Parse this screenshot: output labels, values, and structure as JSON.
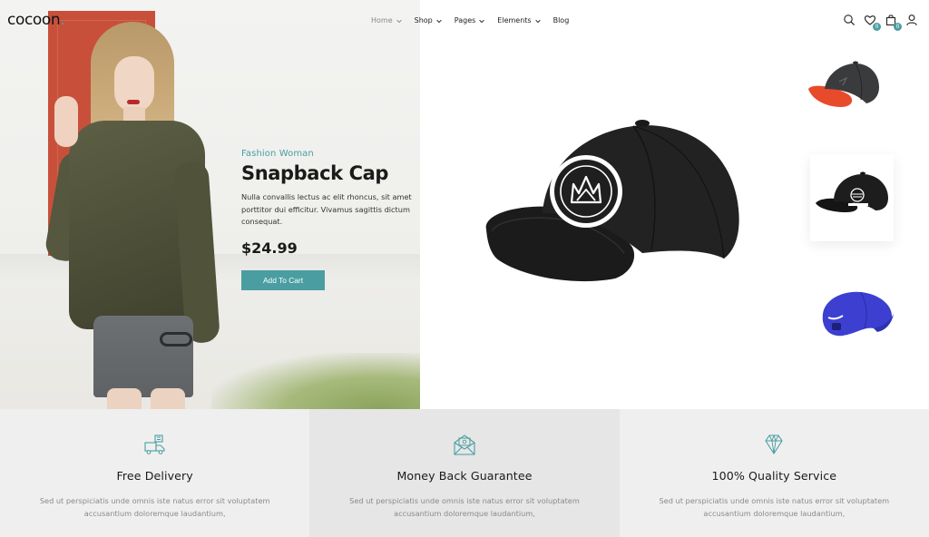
{
  "brand": {
    "logo_text": "cocoon",
    "logo_dot": ".",
    "accent_color": "#4a9ea1"
  },
  "nav": {
    "items": [
      {
        "label": "Home",
        "has_dropdown": true,
        "active": true
      },
      {
        "label": "Shop",
        "has_dropdown": true
      },
      {
        "label": "Pages",
        "has_dropdown": true
      },
      {
        "label": "Elements",
        "has_dropdown": true
      },
      {
        "label": "Blog",
        "has_dropdown": false
      }
    ]
  },
  "header_icons": {
    "search": {
      "icon": "search-icon"
    },
    "wishlist": {
      "icon": "heart-icon",
      "badge": "0"
    },
    "cart": {
      "icon": "shopping-bag-icon",
      "badge": "0"
    },
    "account": {
      "icon": "user-icon"
    }
  },
  "hero": {
    "eyebrow": "Fashion Woman",
    "title": "Snapback Cap",
    "description": "Nulla convallis lectus ac elit rhoncus, sit amet porttitor dui efficitur. Vivamus sagittis dictum consequat.",
    "price": "$24.99",
    "cta_label": "Add To Cart"
  },
  "product_thumbnails": [
    {
      "name": "black-red-snapback"
    },
    {
      "name": "black-one-up-snapback",
      "selected": true
    },
    {
      "name": "blue-nike-cap"
    }
  ],
  "features": [
    {
      "icon": "delivery-truck-icon",
      "title": "Free Delivery",
      "description": "Sed ut perspiciatis unde omnis iste natus error sit voluptatem accusantium doloremque laudantium,"
    },
    {
      "icon": "money-envelope-icon",
      "title": "Money Back Guarantee",
      "description": "Sed ut perspiciatis unde omnis iste natus error sit voluptatem accusantium doloremque laudantium,"
    },
    {
      "icon": "diamond-icon",
      "title": "100% Quality Service",
      "description": "Sed ut perspiciatis unde omnis iste natus error sit voluptatem accusantium doloremque laudantium,"
    }
  ]
}
